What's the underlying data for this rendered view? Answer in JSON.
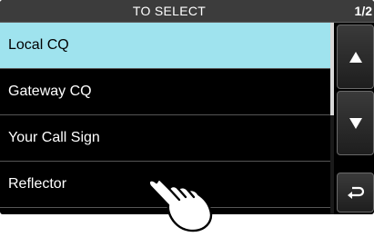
{
  "header": {
    "title": "TO SELECT",
    "page": "1/2"
  },
  "list": {
    "items": [
      {
        "label": "Local CQ",
        "selected": true
      },
      {
        "label": "Gateway CQ",
        "selected": false
      },
      {
        "label": "Your Call Sign",
        "selected": false
      },
      {
        "label": "Reflector",
        "selected": false
      }
    ]
  },
  "buttons": {
    "up_icon": "triangle-up-icon",
    "down_icon": "triangle-down-icon",
    "back_icon": "return-arrow-icon"
  },
  "illustration": {
    "icon": "pointing-hand-icon"
  },
  "colors": {
    "selected_row": "#9fe3ee",
    "background": "#000000",
    "title_bar": "#3c3c3c"
  },
  "scroll": {
    "position_fraction": 0.0,
    "visible_fraction": 0.5
  }
}
